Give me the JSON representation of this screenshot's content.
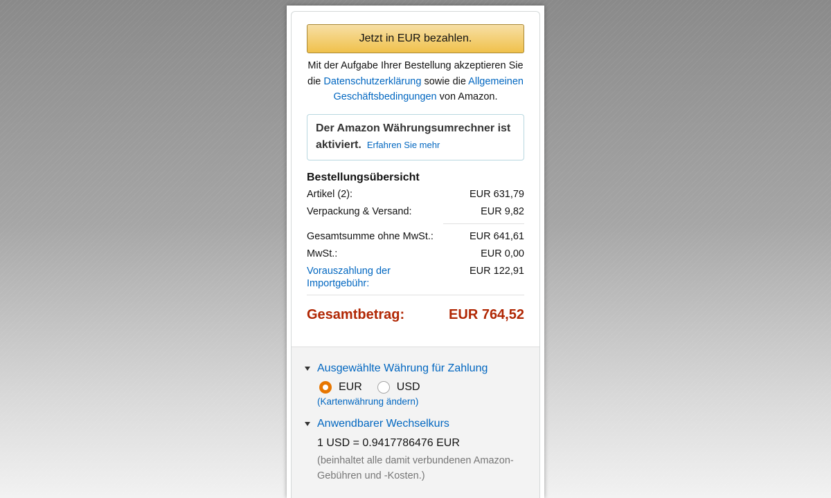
{
  "checkout": {
    "pay_button": "Jetzt in EUR bezahlen.",
    "terms": {
      "part1": "Mit der Aufgabe Ihrer Bestellung akzeptieren Sie die ",
      "privacy_link": "Datenschutzerklärung",
      "part2": " sowie die ",
      "conditions_link": "Allgemeinen Geschäftsbedingungen",
      "part3": " von Amazon."
    },
    "converter_notice": {
      "text": "Der Amazon Währungsumrechner ist aktiviert.",
      "learn_more": "Erfahren Sie mehr"
    }
  },
  "summary": {
    "title": "Bestellungsübersicht",
    "items_label": "Artikel (2):",
    "items_value": "EUR 631,79",
    "shipping_label": "Verpackung & Versand:",
    "shipping_value": "EUR 9,82",
    "subtotal_label": "Gesamtsumme ohne MwSt.:",
    "subtotal_value": "EUR 641,61",
    "vat_label": "MwSt.:",
    "vat_value": "EUR 0,00",
    "import_label": "Vorauszahlung der Importgebühr:",
    "import_value": "EUR 122,91",
    "total_label": "Gesamtbetrag:",
    "total_value": "EUR 764,52"
  },
  "currency": {
    "heading": "Ausgewählte Währung für Zahlung",
    "options": [
      {
        "label": "EUR",
        "selected": true
      },
      {
        "label": "USD",
        "selected": false
      }
    ],
    "change_card_currency": "(Kartenwährung ändern)"
  },
  "exchange": {
    "heading": "Anwendbarer Wechselkurs",
    "rate": "1 USD = 0.9417786476 EUR",
    "note": "(beinhaltet alle damit verbundenen Amazon-Gebühren und -Kosten.)"
  },
  "colors": {
    "total_red": "#b12704",
    "link_blue": "#0066c0",
    "button_yellow": "#f0c14b",
    "radio_orange": "#e77600"
  }
}
